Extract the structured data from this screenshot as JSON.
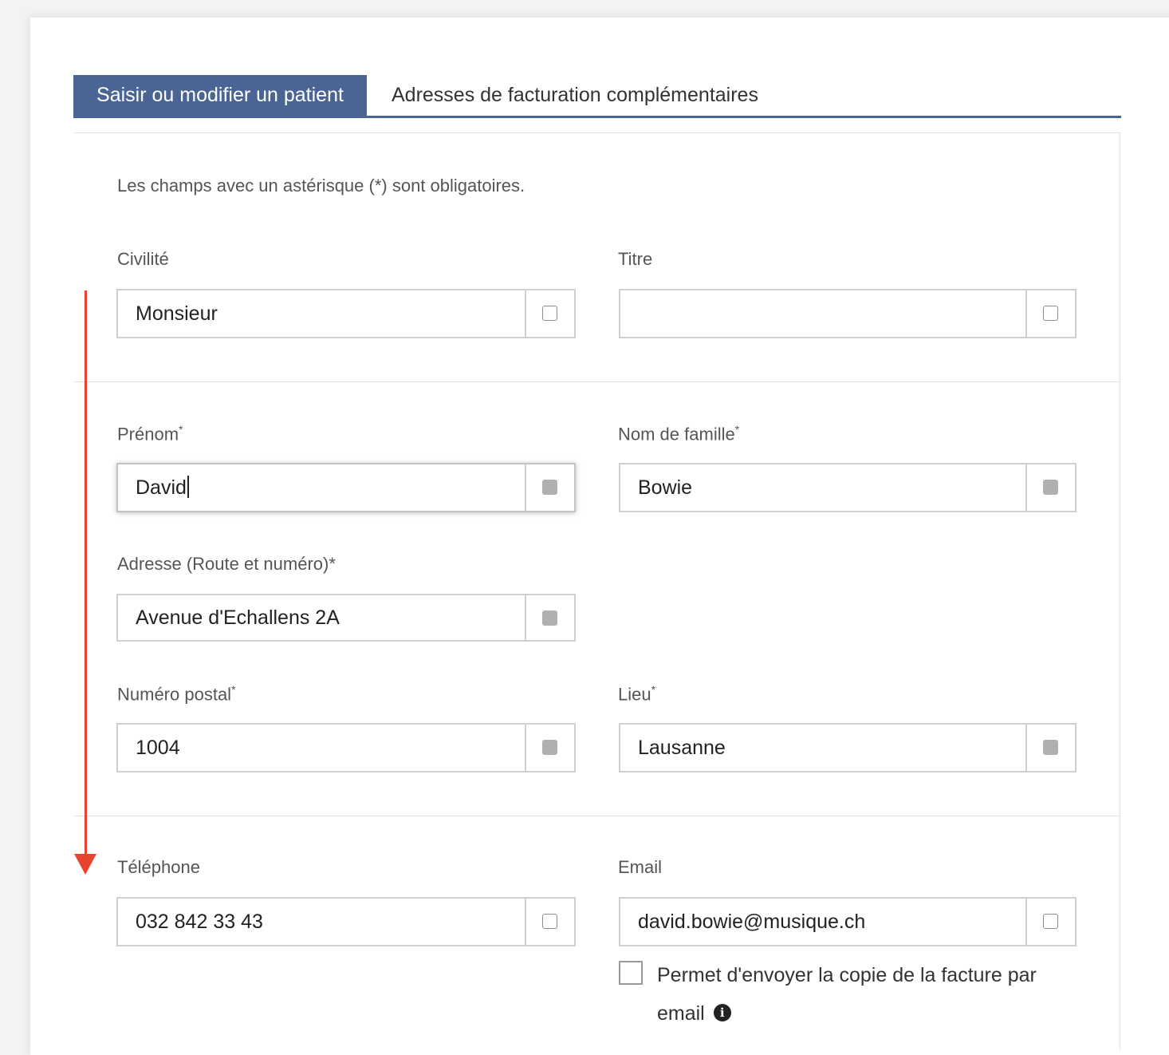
{
  "tabs": [
    {
      "label": "Saisir ou modifier un patient",
      "active": true
    },
    {
      "label": "Adresses de facturation complémentaires",
      "active": false
    }
  ],
  "form": {
    "required_note": "Les champs avec un astérisque (*) sont obligatoires.",
    "civilite": {
      "label": "Civilité",
      "value": "Monsieur"
    },
    "titre": {
      "label": "Titre",
      "value": ""
    },
    "prenom": {
      "label": "Prénom",
      "value": "David"
    },
    "nom": {
      "label": "Nom de famille",
      "value": "Bowie"
    },
    "adresse": {
      "label": "Adresse (Route et numéro)*",
      "value": "Avenue d'Echallens 2A"
    },
    "npa": {
      "label": "Numéro postal",
      "value": "1004"
    },
    "lieu": {
      "label": "Lieu",
      "value": "Lausanne"
    },
    "telephone": {
      "label": "Téléphone",
      "value": "032 842 33 43"
    },
    "email": {
      "label": "Email",
      "value": "david.bowie@musique.ch"
    },
    "email_copy": {
      "label_line1": "Permet d'envoyer la copie de la facture par",
      "label_line2": "email",
      "checked": false
    },
    "required_marker": "*"
  },
  "icons": {
    "info": "info-circle-icon",
    "info_glyph": "i"
  },
  "colors": {
    "accent": "#4a6494",
    "annotation_arrow": "#e8432e"
  }
}
